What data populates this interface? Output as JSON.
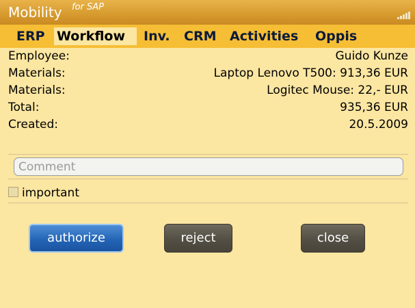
{
  "app": {
    "title": "Mobility",
    "title_suffix": "for SAP"
  },
  "tabs": [
    {
      "label": "ERP",
      "active": false
    },
    {
      "label": "Workflow",
      "active": true
    },
    {
      "label": "Inv.",
      "active": false
    },
    {
      "label": "CRM",
      "active": false
    },
    {
      "label": "Activities",
      "active": false
    },
    {
      "label": "Oppis",
      "active": false
    }
  ],
  "details": [
    {
      "label": "Employee:",
      "value": "Guido Kunze"
    },
    {
      "label": "Materials:",
      "value": "Laptop Lenovo T500: 913,36 EUR"
    },
    {
      "label": "Materials:",
      "value": "Logitec Mouse: 22,- EUR"
    },
    {
      "label": "Total:",
      "value": "935,36 EUR"
    },
    {
      "label": "Created:",
      "value": "20.5.2009"
    }
  ],
  "comment": {
    "placeholder": "Comment",
    "value": ""
  },
  "important": {
    "label": "important",
    "checked": false
  },
  "buttons": {
    "authorize": "authorize",
    "reject": "reject",
    "close": "close"
  },
  "colors": {
    "accent": "#2465b6",
    "tab_bar": "#f6be35",
    "background": "#fbe6a2",
    "title_bar": "#d69a2e"
  },
  "icons": {
    "status": "signal-strength-icon"
  }
}
